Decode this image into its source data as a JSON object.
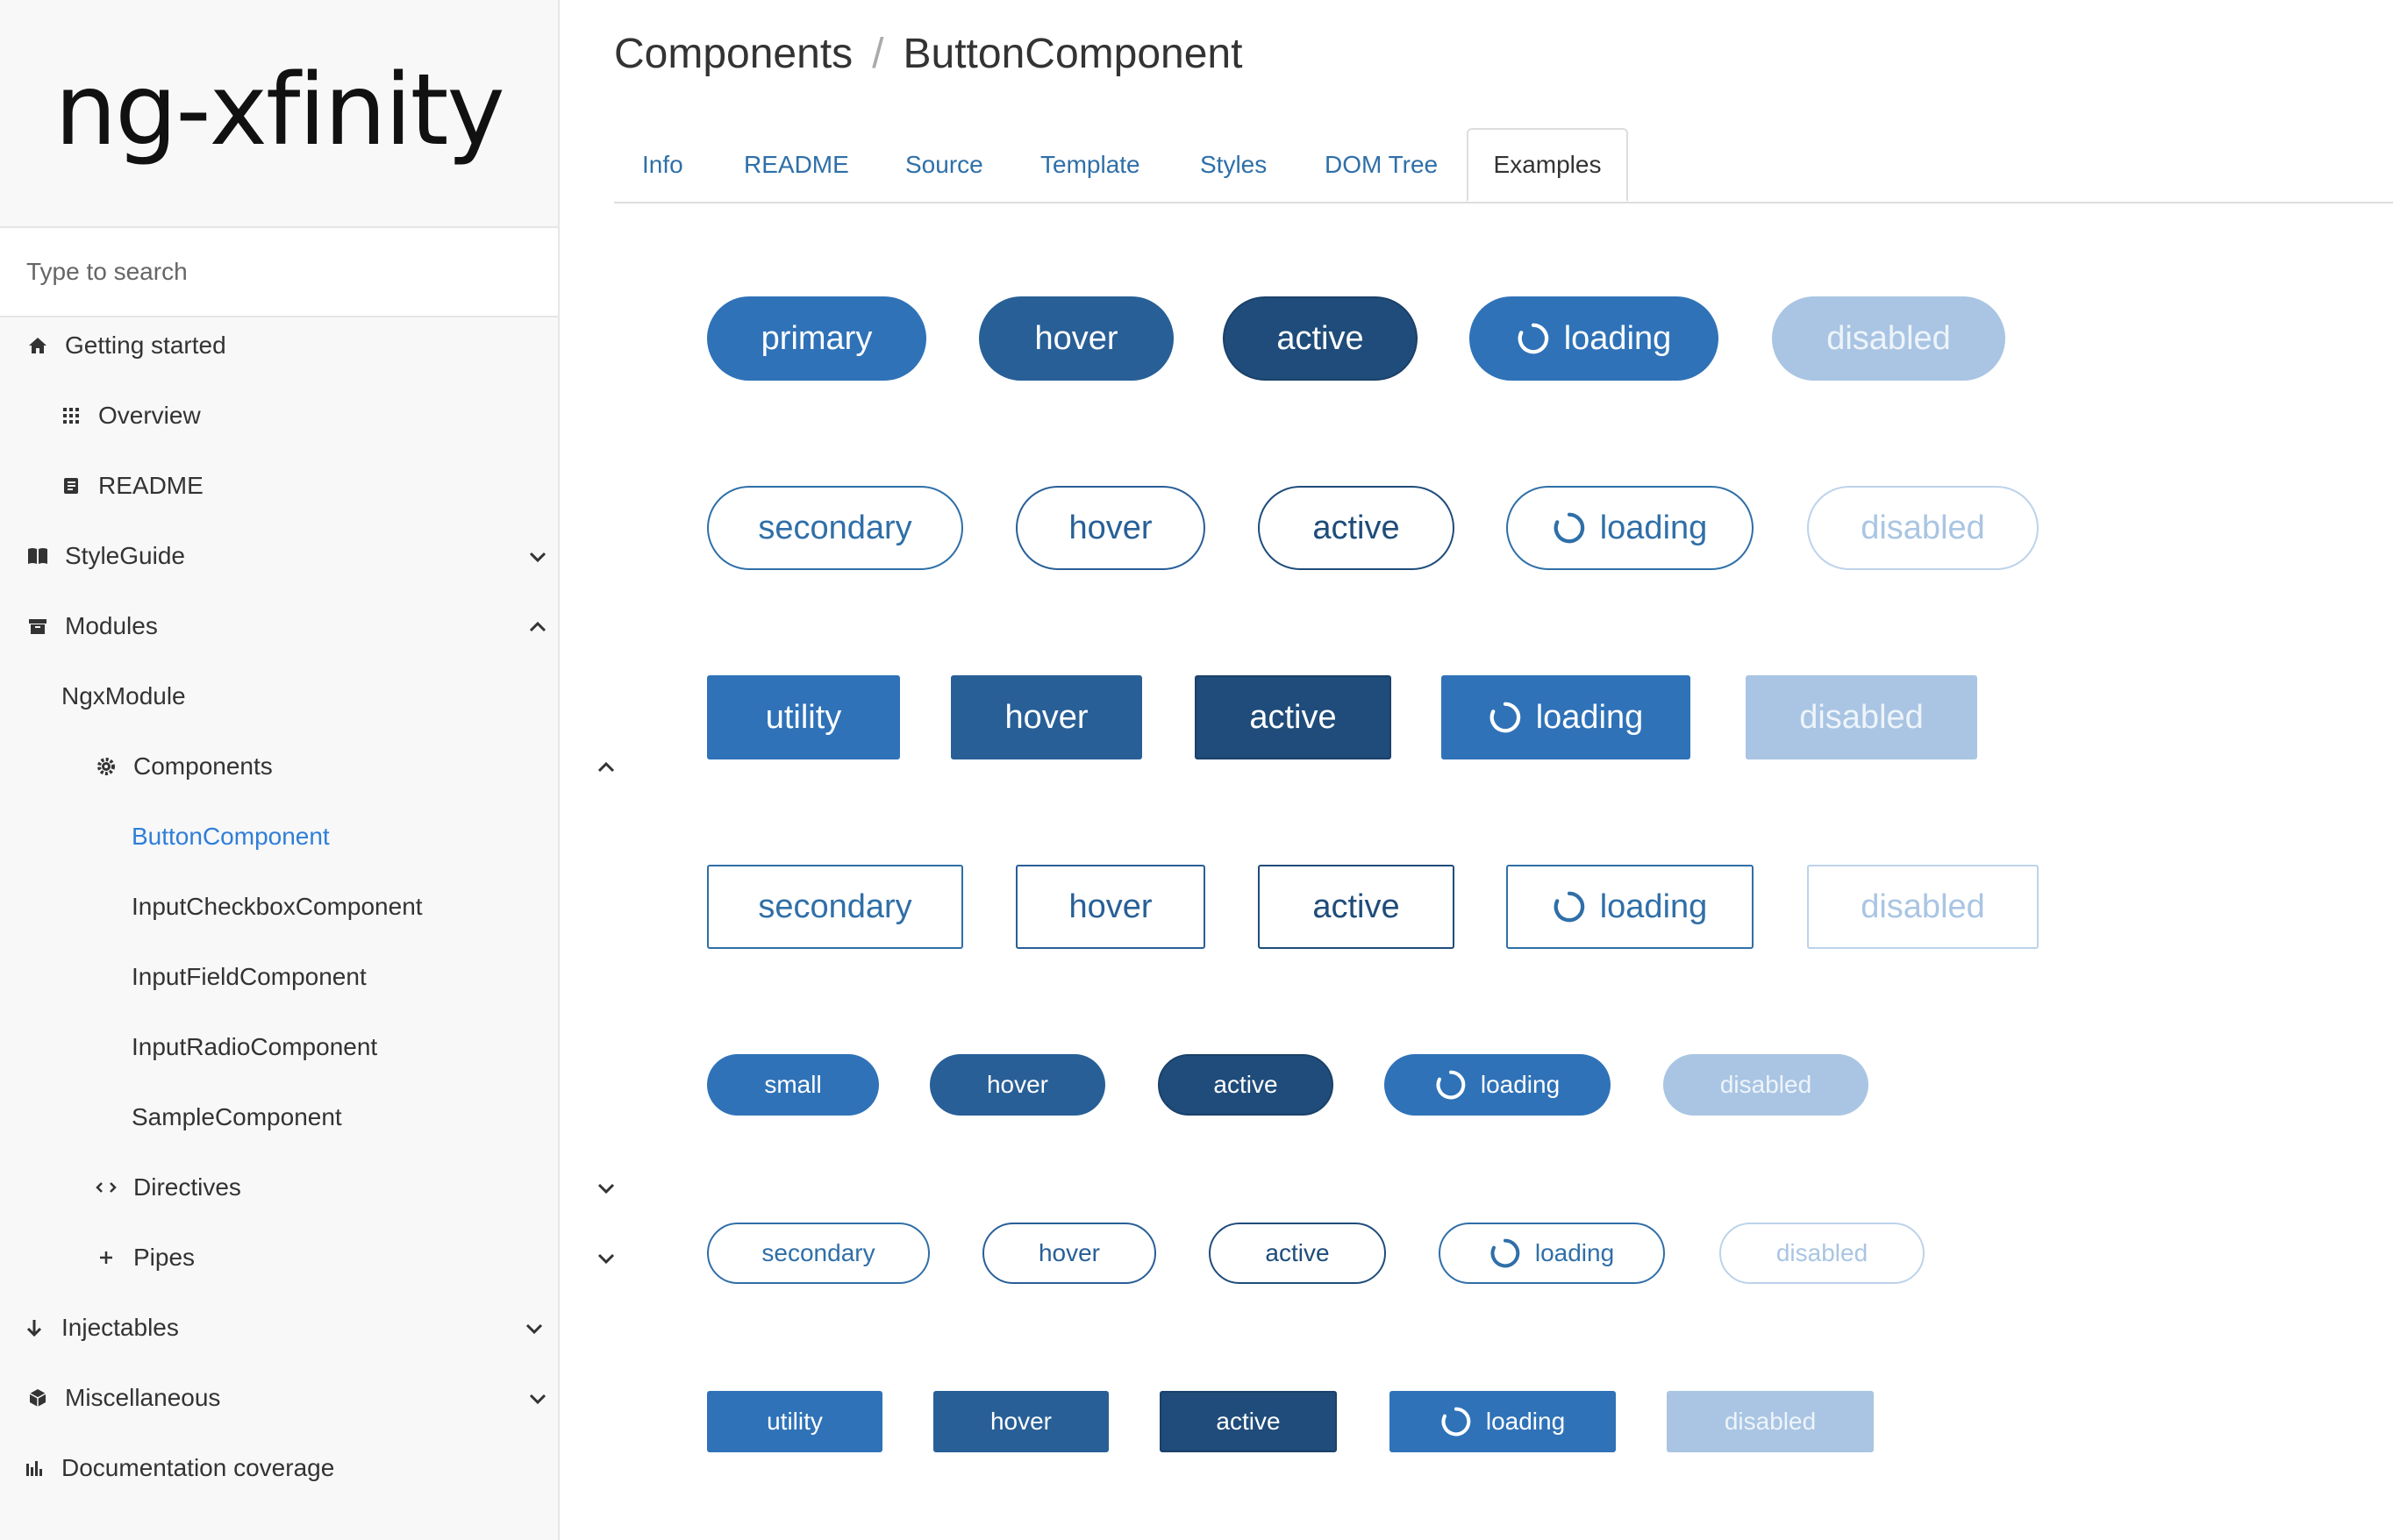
{
  "logo": "ng-xfinity",
  "search": {
    "placeholder": "Type to search"
  },
  "sidebar": {
    "items": [
      {
        "label": "Getting started",
        "icon": "home-icon"
      },
      {
        "label": "Overview",
        "icon": "grid-icon"
      },
      {
        "label": "README",
        "icon": "book-icon"
      },
      {
        "label": "StyleGuide",
        "icon": "open-book-icon"
      },
      {
        "label": "Modules",
        "icon": "archive-icon"
      },
      {
        "label": "NgxModule"
      },
      {
        "label": "Components",
        "icon": "cog-icon"
      },
      {
        "label": "ButtonComponent"
      },
      {
        "label": "InputCheckboxComponent"
      },
      {
        "label": "InputFieldComponent"
      },
      {
        "label": "InputRadioComponent"
      },
      {
        "label": "SampleComponent"
      },
      {
        "label": "Directives",
        "icon": "code-icon"
      },
      {
        "label": "Pipes",
        "icon": "plus-icon"
      },
      {
        "label": "Injectables",
        "icon": "arrow-down-icon"
      },
      {
        "label": "Miscellaneous",
        "icon": "cube-icon"
      },
      {
        "label": "Documentation coverage",
        "icon": "bar-chart-icon"
      }
    ]
  },
  "breadcrumb": {
    "parent": "Components",
    "separator": "/",
    "current": "ButtonComponent"
  },
  "tabs": [
    "Info",
    "README",
    "Source",
    "Template",
    "Styles",
    "DOM Tree",
    "Examples"
  ],
  "selected_tab": "Examples",
  "colors": {
    "primary": "#2f72b8",
    "hover": "#285f97",
    "active": "#1f4c7a",
    "disabled": "#a9c5e3",
    "link": "#2f7ed8"
  },
  "button_rows": [
    {
      "style": "primary pill",
      "labels": [
        "primary",
        "hover",
        "active",
        "loading",
        "disabled"
      ]
    },
    {
      "style": "secondary pill",
      "labels": [
        "secondary",
        "hover",
        "active",
        "loading",
        "disabled"
      ]
    },
    {
      "style": "utility",
      "labels": [
        "utility",
        "hover",
        "active",
        "loading",
        "disabled"
      ]
    },
    {
      "style": "secondary square",
      "labels": [
        "secondary",
        "hover",
        "active",
        "loading",
        "disabled"
      ]
    },
    {
      "style": "small pill",
      "labels": [
        "small",
        "hover",
        "active",
        "loading",
        "disabled"
      ]
    },
    {
      "style": "small secondary pill",
      "labels": [
        "secondary",
        "hover",
        "active",
        "loading",
        "disabled"
      ]
    },
    {
      "style": "small utility",
      "labels": [
        "utility",
        "hover",
        "active",
        "loading",
        "disabled"
      ]
    }
  ]
}
